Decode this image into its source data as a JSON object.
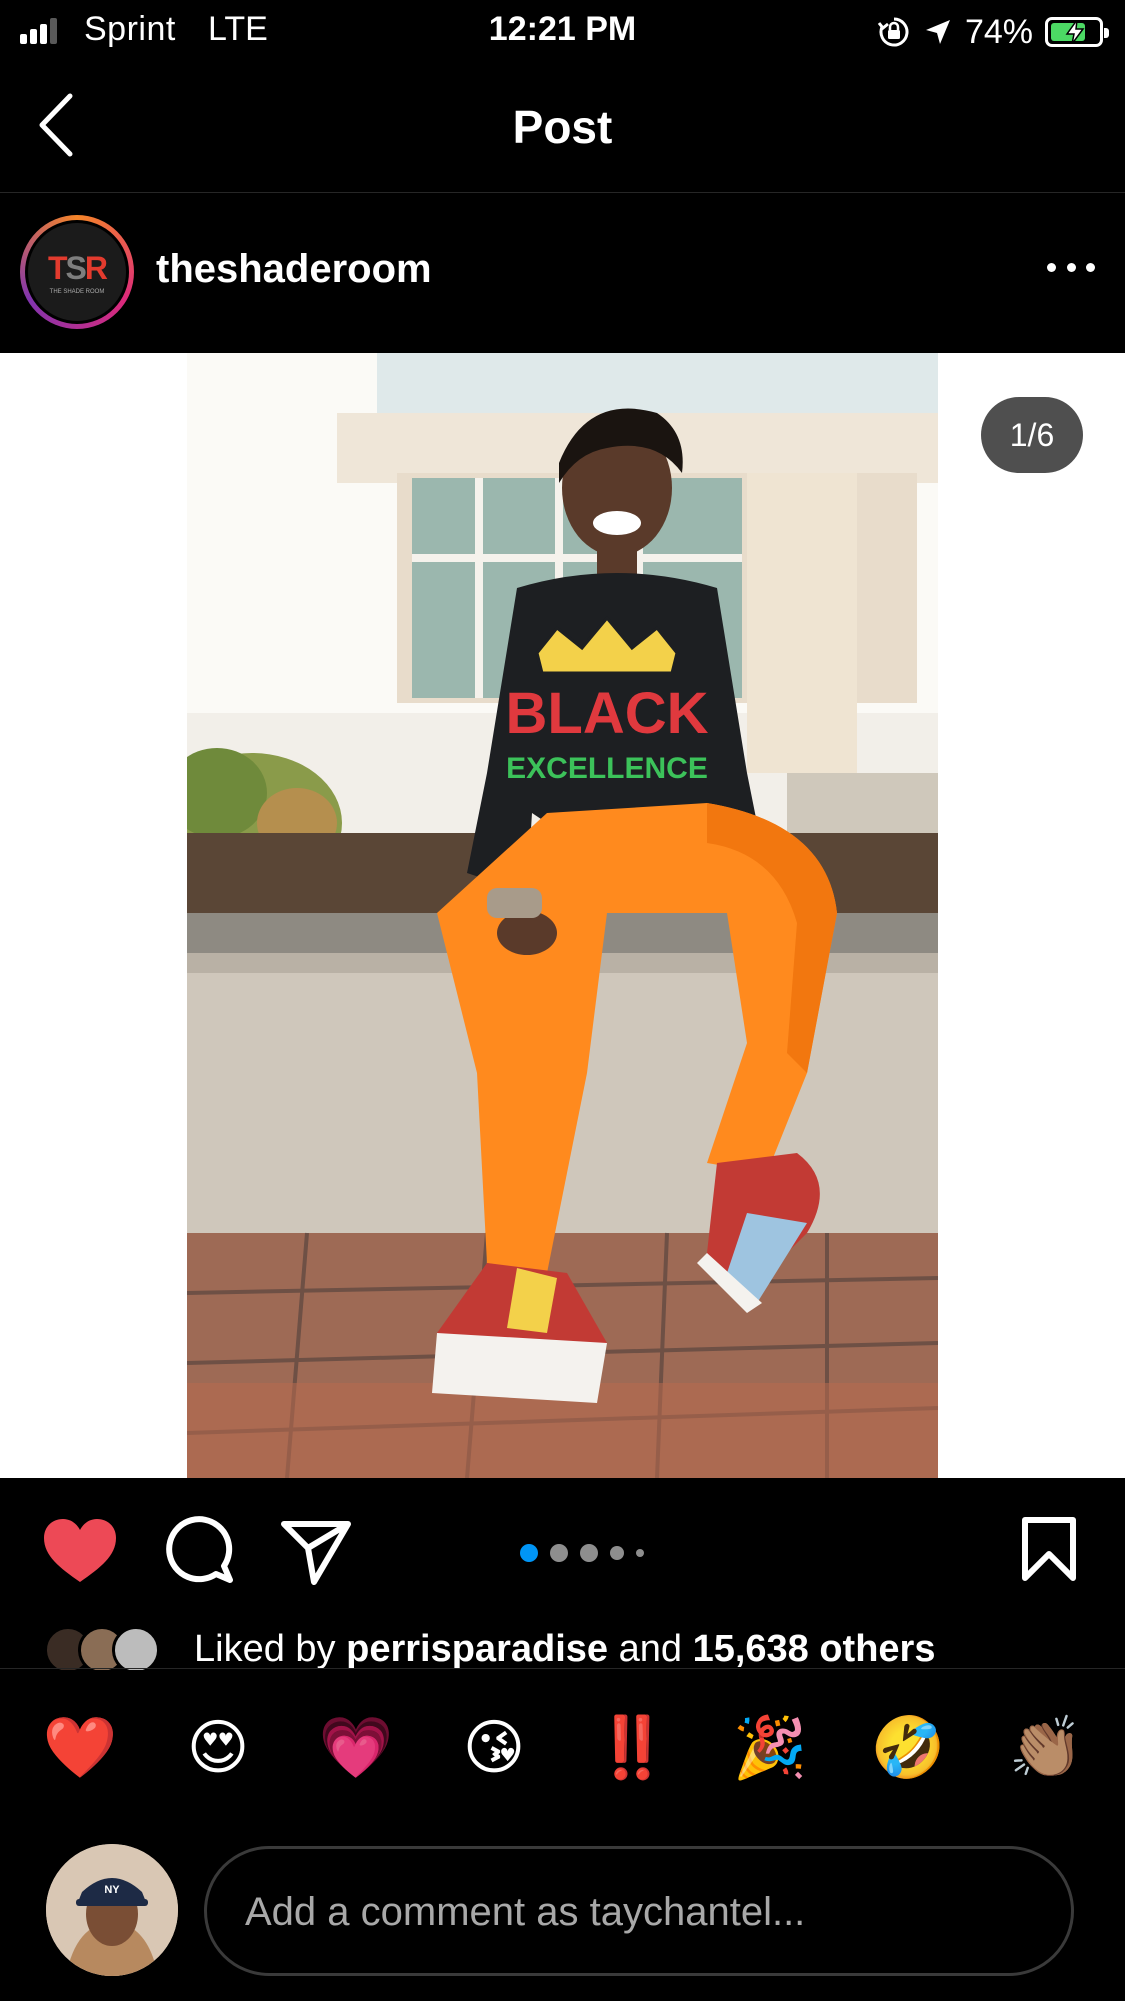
{
  "status_bar": {
    "carrier": "Sprint",
    "network": "LTE",
    "time": "12:21 PM",
    "battery": "74%",
    "battery_level": 0.74,
    "icons": [
      "signal-icon",
      "orientation-lock-icon",
      "location-icon",
      "battery-charging-icon"
    ]
  },
  "nav": {
    "title": "Post",
    "back_icon": "chevron-left-icon"
  },
  "post": {
    "username": "theshaderoom",
    "avatar_logo": "TSR",
    "avatar_logo_sub": "THE SHADE ROOM",
    "more_icon": "more-horizontal-icon",
    "photo": {
      "shirt_crown": "crown",
      "shirt_line1": "BLACK",
      "shirt_line2": "EXCELLENCE"
    },
    "counter": "1/6",
    "carousel_dots": 5,
    "carousel_active_index": 0
  },
  "actions": {
    "like_icon": "heart-filled-icon",
    "comment_icon": "comment-icon",
    "share_icon": "send-icon",
    "save_icon": "bookmark-icon"
  },
  "likes": {
    "prefix": "Liked by",
    "user": "perrisparadise",
    "connector": "and",
    "others": "15,638 others"
  },
  "quick_reactions": [
    "❤️",
    "😍",
    "💗",
    "😘",
    "‼️",
    "🎉",
    "🤣",
    "👏🏽"
  ],
  "composer": {
    "placeholder": "Add a comment as taychantel...",
    "avatar_cap_text": "NY"
  },
  "colors": {
    "background": "#000000",
    "like_red": "#ed4956",
    "active_dot": "#0095f6",
    "inactive_dot": "#8e8e8e",
    "battery_green": "#4cd964"
  }
}
